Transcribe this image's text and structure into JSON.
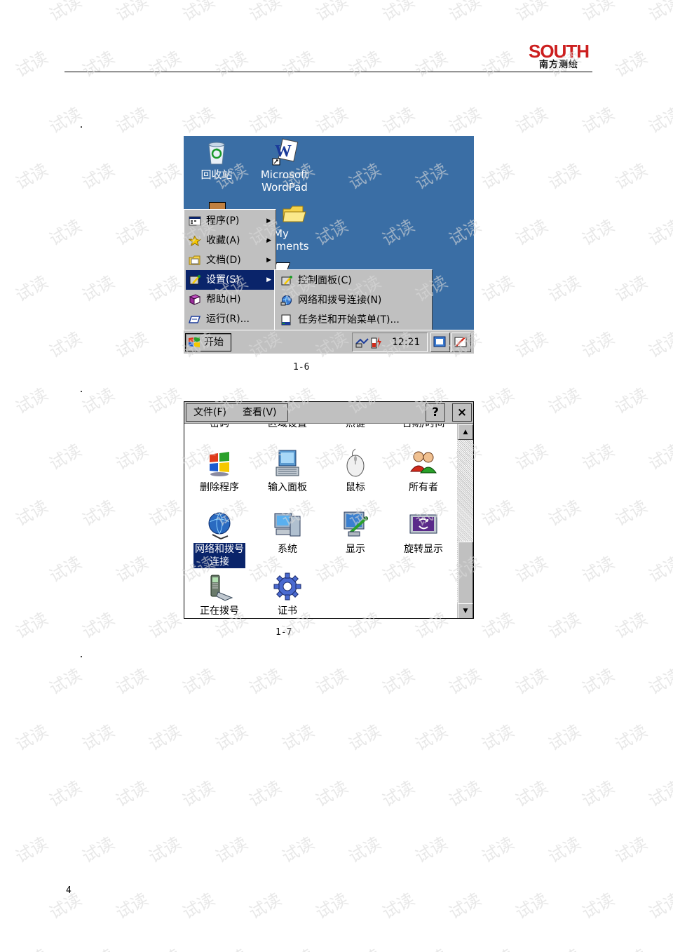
{
  "watermark": {
    "text": "试读"
  },
  "header": {
    "logo": {
      "name": "SOUTH",
      "subtitle": "南方测绘"
    }
  },
  "figure_1_6": {
    "caption": "1-6",
    "desktop_icons": [
      {
        "label_lines": [
          "回收站"
        ],
        "icon": "recycle-bin-icon"
      },
      {
        "label_lines": [
          "Microsoft",
          "WordPad"
        ],
        "icon": "wordpad-icon"
      },
      {
        "label_lines": [
          "My",
          "uments"
        ],
        "icon": "folder-icon"
      }
    ],
    "start_menu": {
      "items": [
        {
          "label": "程序(P)",
          "icon": "programs-icon",
          "has_submenu": true
        },
        {
          "label": "收藏(A)",
          "icon": "favorites-star-icon",
          "has_submenu": true
        },
        {
          "label": "文档(D)",
          "icon": "documents-icon",
          "has_submenu": true
        },
        {
          "label": "设置(S)",
          "icon": "settings-icon",
          "has_submenu": true,
          "selected": true
        },
        {
          "label": "帮助(H)",
          "icon": "help-book-icon",
          "has_submenu": false
        },
        {
          "label": "运行(R)...",
          "icon": "run-icon",
          "has_submenu": false
        }
      ]
    },
    "settings_submenu": {
      "items": [
        {
          "label": "控制面板(C)",
          "icon": "control-panel-icon"
        },
        {
          "label": "网络和拨号连接(N)",
          "icon": "network-icon"
        },
        {
          "label": "任务栏和开始菜单(T)...",
          "icon": "taskbar-icon"
        }
      ]
    },
    "taskbar": {
      "start_label": "开始",
      "clock": "12:21"
    }
  },
  "figure_1_7": {
    "caption": "1-7",
    "menu": [
      "文件(F)",
      "查看(V)"
    ],
    "help_label": "?",
    "close_label": "×",
    "cut_off_labels": [
      "密码",
      "区域设置",
      "热键",
      "日期/时间"
    ],
    "icons": [
      {
        "label": "删除程序",
        "icon": "remove-programs-icon"
      },
      {
        "label": "输入面板",
        "icon": "input-panel-icon"
      },
      {
        "label": "鼠标",
        "icon": "mouse-icon"
      },
      {
        "label": "所有者",
        "icon": "owner-icon"
      },
      {
        "label_lines": [
          "网络和拨号",
          "连接"
        ],
        "icon": "network-globe-icon",
        "selected": true
      },
      {
        "label": "系统",
        "icon": "system-icon"
      },
      {
        "label": "显示",
        "icon": "display-icon"
      },
      {
        "label": "旋转显示",
        "icon": "rotate-display-icon"
      },
      {
        "label": "正在拨号",
        "icon": "dialing-phone-icon"
      },
      {
        "label": "证书",
        "icon": "certificates-gear-icon"
      }
    ]
  },
  "footer": {
    "page_number": "4"
  }
}
